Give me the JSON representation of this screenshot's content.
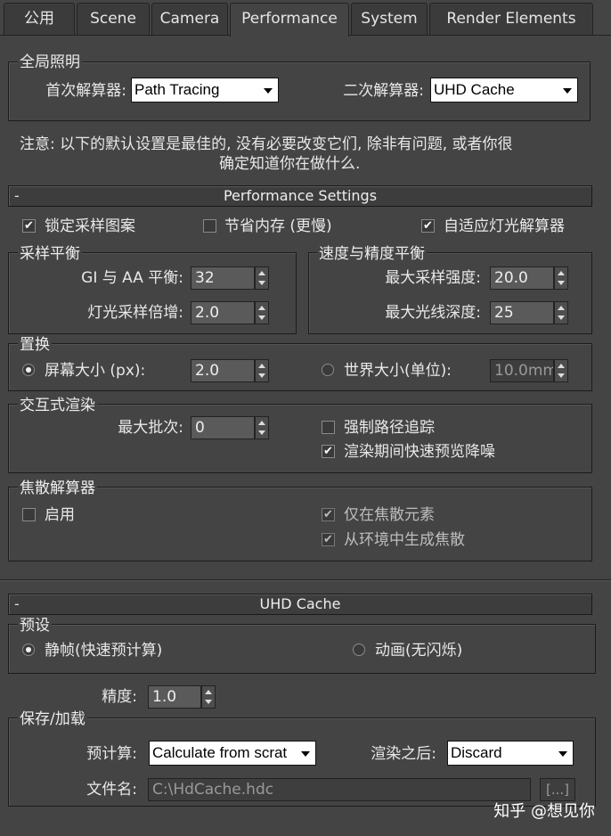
{
  "tabs": [
    "公用",
    "Scene",
    "Camera",
    "Performance",
    "System",
    "Render Elements"
  ],
  "active_tab": "Performance",
  "gi": {
    "title": "全局照明",
    "primary_label": "首次解算器:",
    "primary_value": "Path Tracing",
    "secondary_label": "二次解算器:",
    "secondary_value": "UHD Cache"
  },
  "note": {
    "line1": "注意: 以下的默认设置是最佳的, 没有必要改变它们, 除非有问题, 或者你很",
    "line2": "确定知道你在做什么."
  },
  "performance": {
    "rollout_title": "Performance Settings",
    "collapse": "-",
    "lock_pattern": {
      "label": "锁定采样图案",
      "checked": true
    },
    "save_memory": {
      "label": "节省内存 (更慢)",
      "checked": false
    },
    "adaptive_light": {
      "label": "自适应灯光解算器",
      "checked": true
    },
    "sampling": {
      "title": "采样平衡",
      "gi_aa_label": "GI 与 AA 平衡:",
      "gi_aa_value": "32",
      "light_mult_label": "灯光采样倍增:",
      "light_mult_value": "2.0"
    },
    "speed": {
      "title": "速度与精度平衡",
      "max_intensity_label": "最大采样强度:",
      "max_intensity_value": "20.0",
      "max_depth_label": "最大光线深度:",
      "max_depth_value": "25"
    },
    "displacement": {
      "title": "置换",
      "screen_label": "屏幕大小 (px):",
      "screen_value": "2.0",
      "screen_selected": true,
      "world_label": "世界大小(单位):",
      "world_value": "10.0mm",
      "world_selected": false
    },
    "interactive": {
      "title": "交互式渲染",
      "max_batch_label": "最大批次:",
      "max_batch_value": "0",
      "force_path": {
        "label": "强制路径追踪",
        "checked": false
      },
      "denoise": {
        "label": "渲染期间快速预览降噪",
        "checked": true
      }
    },
    "caustics": {
      "title": "焦散解算器",
      "enable": {
        "label": "启用",
        "checked": false
      },
      "only_caustic": {
        "label": "仅在焦散元素",
        "checked": true
      },
      "from_env": {
        "label": "从环境中生成焦散",
        "checked": true
      }
    }
  },
  "uhd": {
    "rollout_title": "UHD Cache",
    "collapse": "-",
    "preset": {
      "title": "预设",
      "still": "静帧(快速预计算)",
      "still_selected": true,
      "anim": "动画(无闪烁)",
      "anim_selected": false
    },
    "precision_label": "精度:",
    "precision_value": "1.0",
    "save_load": {
      "title": "保存/加载",
      "precalc_label": "预计算:",
      "precalc_value": "Calculate from scrat",
      "after_label": "渲染之后:",
      "after_value": "Discard",
      "file_label": "文件名:",
      "file_value": "C:\\HdCache.hdc",
      "browse": "[...]"
    }
  },
  "watermark": "知乎 @想见你"
}
